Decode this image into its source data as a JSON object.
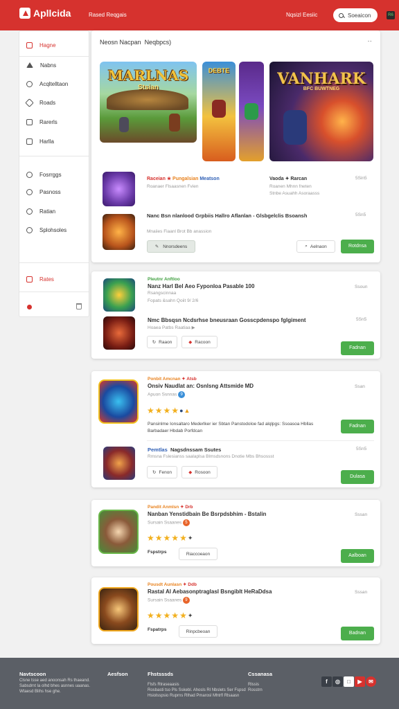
{
  "header": {
    "logo_text": "Apllcida",
    "nav_link": "Rased Reqgais",
    "account_link": "Nqsizl Eesiic",
    "search_label": "Soeaicon",
    "badge": "R6"
  },
  "sidebar": {
    "items": [
      {
        "label": "Hagne",
        "icon": "grid-icon"
      },
      {
        "label": "Nabns",
        "icon": "home-icon"
      },
      {
        "label": "Acqltelltaon",
        "icon": "circle-icon"
      },
      {
        "label": "Roads",
        "icon": "tag-icon"
      },
      {
        "label": "Rarerls",
        "icon": "box-icon"
      },
      {
        "label": "Harlla",
        "icon": "image-icon"
      },
      {
        "label": "Fosrrggs",
        "icon": "camera-icon"
      },
      {
        "label": "Pasnoss",
        "icon": "face-icon"
      },
      {
        "label": "Ratian",
        "icon": "people-icon"
      },
      {
        "label": "Splohsoles",
        "icon": "settings-icon"
      },
      {
        "label": "Rates",
        "icon": "flag-icon"
      }
    ]
  },
  "featured": {
    "title": "Neosn Nacpan",
    "title_extra": "Neqbpcs)",
    "more": "··",
    "banner1_title": "MARLNAS",
    "banner1_sub": "Stsian",
    "banner2_title": "DEBTE",
    "banner3_title": "VANHARK",
    "banner3_sub": "BFC BUWTNEG"
  },
  "featured_items": [
    {
      "category_a": "Raceian",
      "category_b": "Pungalsian",
      "category_c": "Meatson",
      "meta_a": "Roanaer Flsaasnen Fvien",
      "title_b": "Vaoda ✦ Rarcan",
      "meta_b": "Roanen Mhnn fneten",
      "meta_b2": "Stnbe Asuahh Asoraasss",
      "time": "5Sin5"
    },
    {
      "title": "Nanc Bsn nlanlood Grpbiis Hallro Aflanlan - Glsbgelclis Bsoansh",
      "meta": "Mnaiies Fiaanl Brot Bb anassion",
      "time": "5Sn5"
    }
  ],
  "featured_actions": {
    "left_button": "Nnorsdeens",
    "mid_button": "Aelnaon",
    "right_button": "Rotdnsa"
  },
  "card2": {
    "category": "Pleutnr Anftloo",
    "title": "Nanz Harl Bel Aeo Fyponloa Pasable 100",
    "sub": "Rsangscinnaa",
    "meta": "Fopats &sahn Qoiit 9/ 2/6",
    "time": "Ssoun",
    "title2": "Nmc Bbsqsn Ncdsrhse bneusraan Gosscpdenspo fglgiment",
    "meta2": "Hoaea Patbs Raatiaa ▶",
    "time2": "5Sn5",
    "btn1": "Raaon",
    "btn2": "Racoon",
    "btn_green": "Fadnan"
  },
  "card3": {
    "category": "Ponbit Amcnan",
    "category_tag": "✦ Atsb",
    "title": "Onsiv Naudlat an: Osnlsng Attsmide  MD",
    "meta": "Apuon Ssnnas",
    "badge": "9",
    "time": "Ssan",
    "rating": 4.5,
    "desc": "Pansinlme Ionsaltaro Mederlker ier Sbtan Panstodoloe fad alqlpgs: Ssoasoa Hbllas Barbadaer Hbdab Porfdcan",
    "btn_green": "Fadnan",
    "category2": "Pemtlas",
    "title2": "Nagsdnssam Ssutes",
    "meta2": "Rmsna Fslesianss saalaplsa Blmsdsnons Dnotie Mbs Bhsossst",
    "time2": "5Sn5",
    "btn1": "Fenon",
    "btn2": "Rosoon",
    "btn_green2": "Dulasa"
  },
  "card4": {
    "category": "Pandit Anmlsn",
    "category_tag": "✦ Drb",
    "title": "Nanban Yenstidbain Be Bsrpdsbhim - Bstalin",
    "meta": "Sursain Ssaanes",
    "badge": "5",
    "time": "Sssan",
    "rating": 4.5,
    "label": "Fspstrps",
    "btn_outline": "Riaccoeaon",
    "btn_green": "Aalboan"
  },
  "card5": {
    "category": "Pousdt Aunlasn",
    "category_tag": "✦ Ddb",
    "title": "Rastal Al Aebasonptraglasl Bsngiblt HeRaDdsa",
    "meta": "Sursain Ssaanes",
    "badge": "9",
    "time": "Sssan",
    "rating": 5,
    "label": "Fspatrps",
    "btn_outline": "Rinpcbeoan",
    "btn_green": "Badnan"
  },
  "footer": {
    "col1_title": "Navtscoon",
    "col1_lines": [
      "Clsne tsse aed anoonsah Rs thaeand.",
      "Sabsdrnt la olhd bhes asnnes uaanas.",
      "Wtaesd Blihs hse ghe."
    ],
    "col2_title": "Aesfson",
    "col3_title": "Fhstsssds",
    "col3_lines": [
      "Flsfs Rlraseaasis",
      "Rosbasti tso Pls Sskebl. Ahosls Rl Nbslets Ser Fspsd",
      "Hsiolsspsio Ruprns Rlhad Pmarosl Mhtrfl Rlsaasn"
    ],
    "col4_title": "Cssanasa",
    "col4_lines": [
      "Rlssis",
      "Rosstrn"
    ],
    "social": [
      {
        "icon": "facebook-icon",
        "glyph": "f",
        "color": "#3a3f47"
      },
      {
        "icon": "globe-icon",
        "glyph": "◎",
        "color": "#3a3f47"
      },
      {
        "icon": "square-icon",
        "glyph": "□",
        "color": "#ffffff"
      },
      {
        "icon": "youtube-icon",
        "glyph": "▶",
        "color": "#d6322e"
      },
      {
        "icon": "chat-icon",
        "glyph": "✉",
        "color": "#d6322e"
      }
    ]
  },
  "colors": {
    "brand": "#d6322e",
    "accent_green": "#4cae4c",
    "footer": "#5b5f66"
  }
}
